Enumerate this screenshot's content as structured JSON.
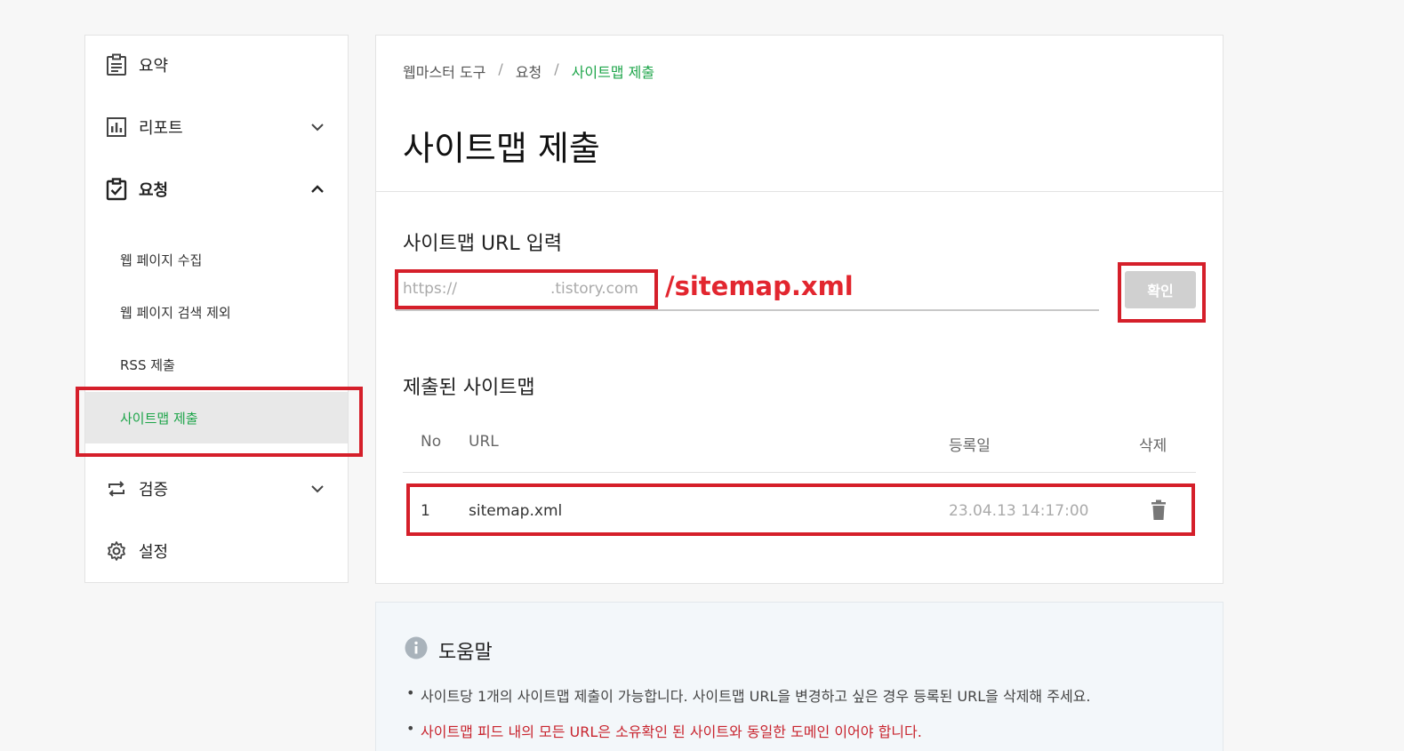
{
  "sidebar": {
    "items": [
      {
        "label": "요약"
      },
      {
        "label": "리포트"
      },
      {
        "label": "요청"
      },
      {
        "label": "검증"
      },
      {
        "label": "설정"
      }
    ],
    "sub_items": [
      {
        "label": "웹 페이지 수집"
      },
      {
        "label": "웹 페이지 검색 제외"
      },
      {
        "label": "RSS 제출"
      },
      {
        "label": "사이트맵 제출"
      }
    ]
  },
  "breadcrumb": {
    "items": [
      "웹마스터 도구",
      "요청",
      "사이트맵 제출"
    ],
    "separator": "/"
  },
  "main": {
    "title": "사이트맵 제출",
    "url_section_label": "사이트맵 URL 입력",
    "url_prefix_start": "https://",
    "url_prefix_end": ".tistory.com",
    "url_suffix_annotation": "/sitemap.xml",
    "confirm_label": "확인",
    "submitted_label": "제출된 사이트맵",
    "table": {
      "headers": [
        "No",
        "URL",
        "등록일",
        "삭제"
      ],
      "rows": [
        {
          "no": "1",
          "url": "sitemap.xml",
          "date": "23.04.13 14:17:00"
        }
      ]
    }
  },
  "help": {
    "title": "도움말",
    "lines": [
      "사이트당 1개의 사이트맵 제출이 가능합니다. 사이트맵 URL을 변경하고 싶은 경우 등록된 URL을 삭제해 주세요.",
      "사이트맵 피드 내의 모든 URL은 소유확인 된 사이트와 동일한 도메인 이어야 합니다."
    ]
  },
  "colors": {
    "accent_green": "#1ea54a",
    "annotation_red": "#d51f2a",
    "warning_red": "#c8242e"
  }
}
